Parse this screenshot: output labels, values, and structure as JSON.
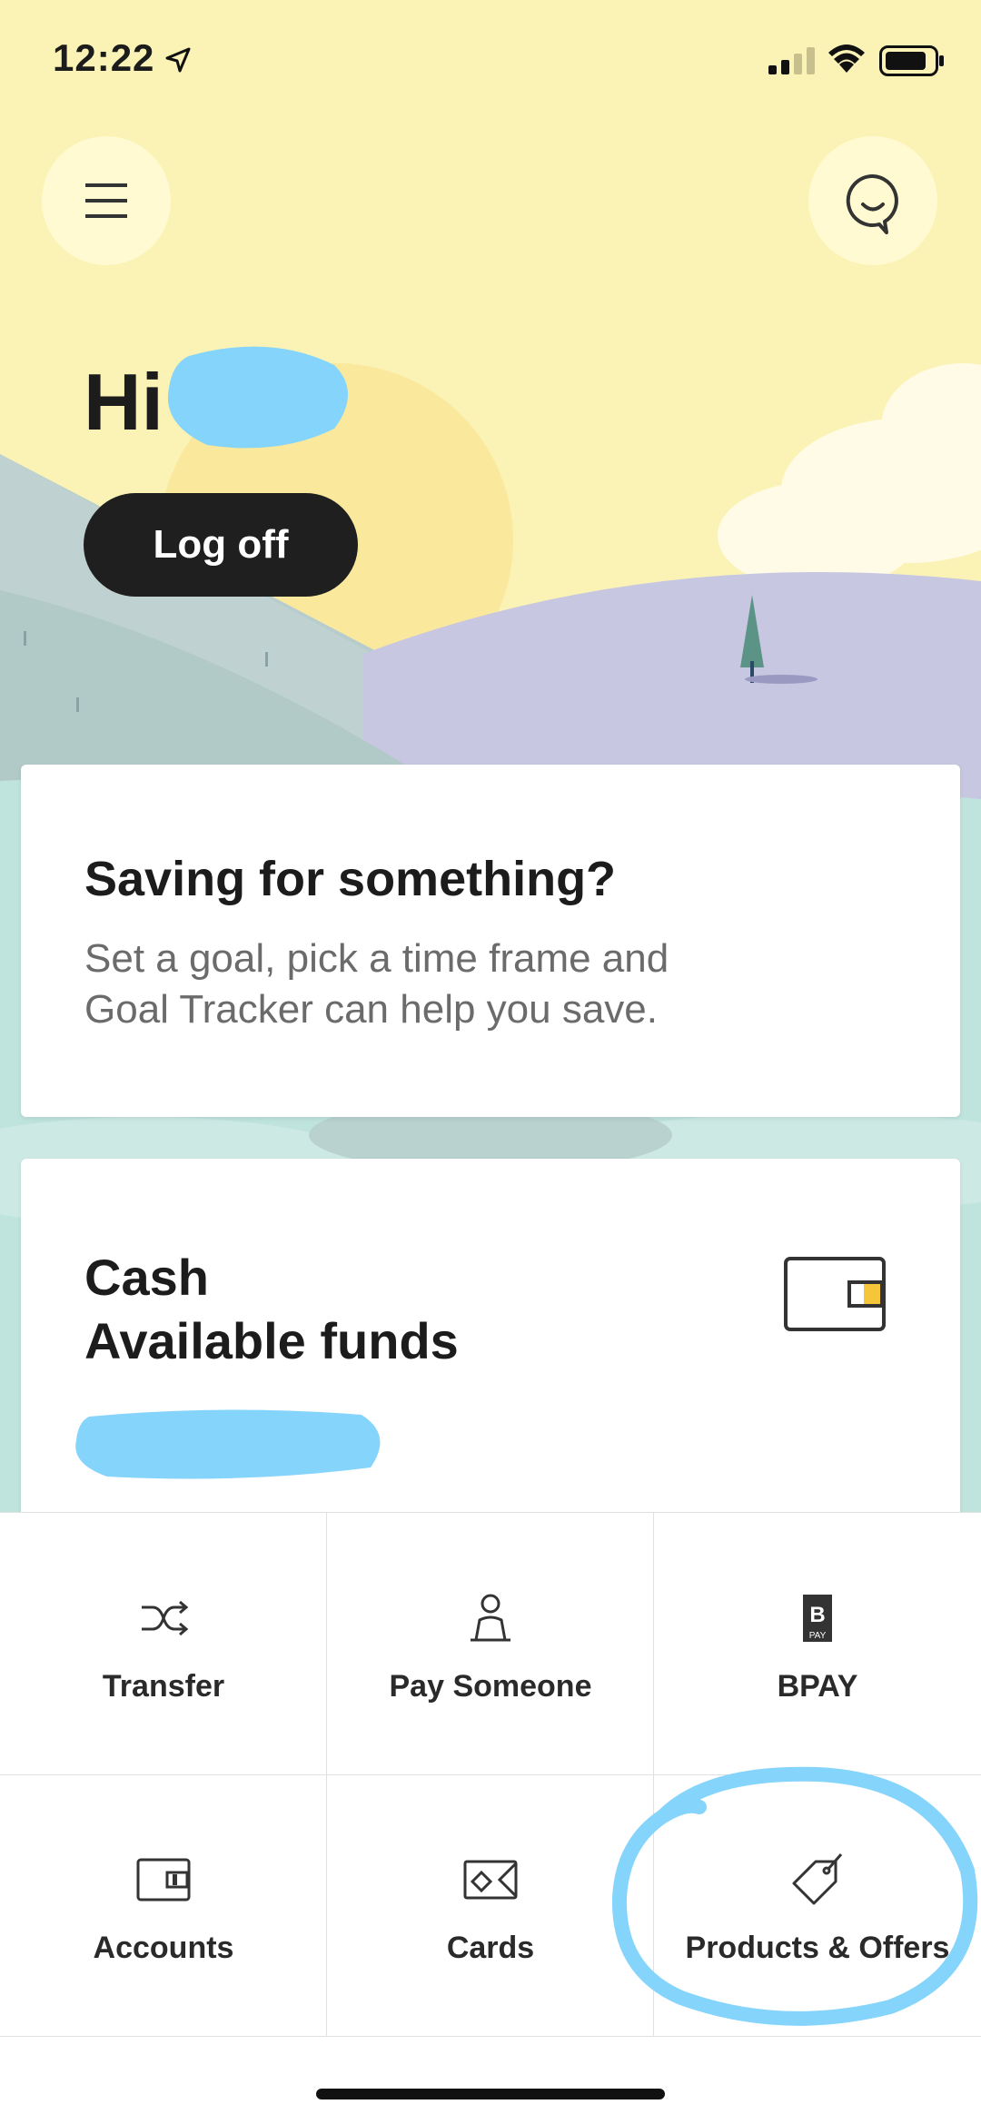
{
  "status_bar": {
    "time": "12:22"
  },
  "header": {
    "menu_icon": "hamburger-menu-icon",
    "chat_icon": "chat-bubble-icon"
  },
  "greeting": {
    "text": "Hi",
    "name_redacted": true
  },
  "logoff": {
    "label": "Log off"
  },
  "saving_card": {
    "title": "Saving for something?",
    "description": "Set a goal, pick a time frame and Goal Tracker can help you save."
  },
  "cash_card": {
    "title": "Cash\nAvailable funds",
    "icon": "wallet-icon",
    "amount_redacted": true
  },
  "quick_actions": [
    {
      "label": "Transfer",
      "icon": "transfer-shuffle-icon"
    },
    {
      "label": "Pay Someone",
      "icon": "person-icon"
    },
    {
      "label": "BPAY",
      "icon": "bpay-icon"
    },
    {
      "label": "Accounts",
      "icon": "wallet-icon"
    },
    {
      "label": "Cards",
      "icon": "card-icon"
    },
    {
      "label": "Products & Offers",
      "icon": "tag-icon"
    }
  ],
  "colors": {
    "sky": "#fbf3b5",
    "hills_blue": "#b9cfd0",
    "hills_purple": "#c7c6e2",
    "redaction": "#85d4fb",
    "accent_yellow": "#f5c53a"
  }
}
